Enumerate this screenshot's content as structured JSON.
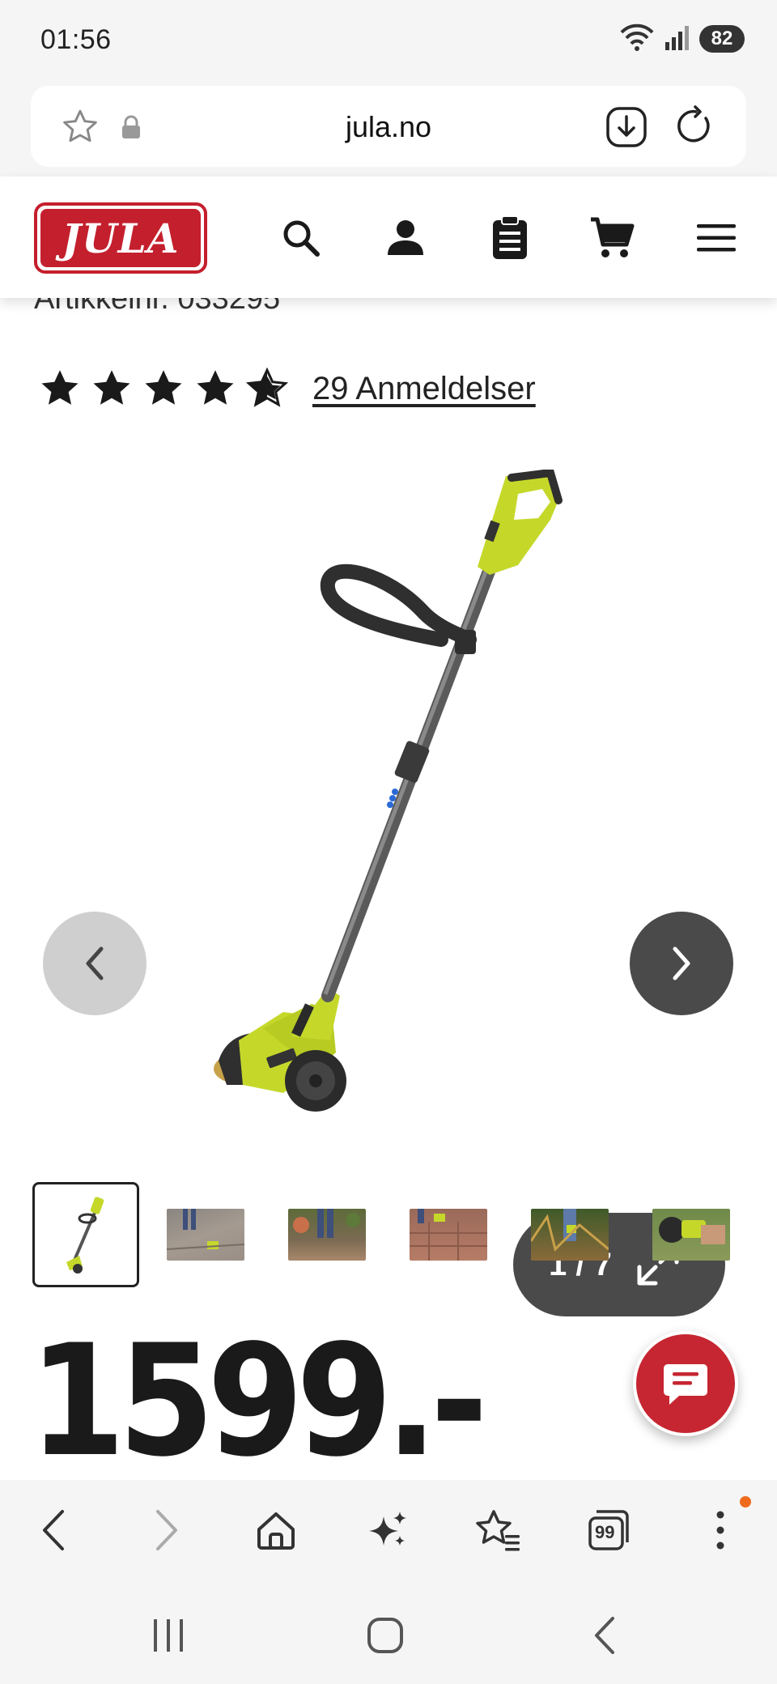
{
  "status_bar": {
    "time": "01:56",
    "battery": "82",
    "icons": [
      "wifi-icon",
      "signal-icon",
      "battery-icon"
    ]
  },
  "browser": {
    "url": "jula.no",
    "icons": [
      "bookmark-star-icon",
      "lock-icon",
      "download-icon",
      "reload-icon"
    ]
  },
  "site_header": {
    "logo_text": "JULA",
    "brand_color": "#c41f2d",
    "icons": [
      "search-icon",
      "account-icon",
      "shopping-list-icon",
      "cart-icon",
      "menu-icon"
    ]
  },
  "product": {
    "article_number": "Artikkelnr. 033295",
    "rating": 4.5,
    "rating_max": 5,
    "reviews_label": "29 Anmeldelser",
    "gallery_counter": "1 / 7",
    "thumbnails": [
      "thumb-1",
      "thumb-2",
      "thumb-3",
      "thumb-4",
      "thumb-5",
      "thumb-6"
    ],
    "price": "1599.-",
    "accent_color": "#c5d82a"
  },
  "toolbar": {
    "icons": [
      "back-icon",
      "forward-icon",
      "home-icon",
      "ai-sparkle-icon",
      "bookmarks-icon",
      "tabs-icon",
      "more-icon"
    ],
    "tabs_count": "99"
  },
  "android_nav": {
    "icons": [
      "recents-icon",
      "home-circle-icon",
      "back-chevron-icon"
    ]
  }
}
